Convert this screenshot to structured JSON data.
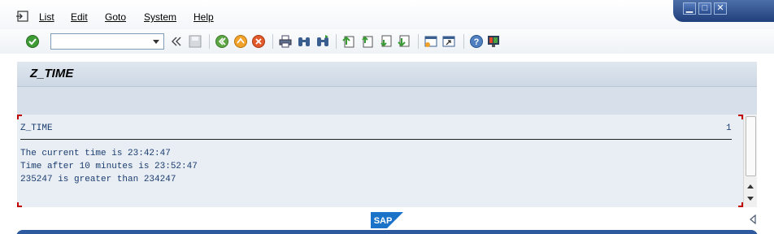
{
  "menubar": {
    "items": [
      {
        "label": "List"
      },
      {
        "label": "Edit"
      },
      {
        "label": "Goto"
      },
      {
        "label": "System"
      },
      {
        "label": "Help"
      }
    ]
  },
  "window_controls": {
    "minimize": "▁",
    "maximize": "□",
    "close": "✕"
  },
  "toolbar": {
    "command_field_value": "",
    "icons": [
      "enter-icon",
      "save-icon",
      "back-icon",
      "exit-icon",
      "cancel-icon",
      "print-icon",
      "find-icon",
      "find-next-icon",
      "first-page-icon",
      "previous-page-icon",
      "next-page-icon",
      "last-page-icon",
      "create-session-icon",
      "shortcut-icon",
      "help-icon",
      "customize-layout-icon"
    ]
  },
  "title": {
    "text": "Z_TIME"
  },
  "list": {
    "header_title": "Z_TIME",
    "page_number": "1",
    "lines": [
      "The current time is 23:42:47",
      "Time after 10 minutes is 23:52:47",
      "235247  is greater than  234247"
    ]
  },
  "footer": {
    "logo": "SAP"
  },
  "colors": {
    "accent": "#2d5a9e",
    "list_text": "#1a3c6e",
    "title_bg": "#d7e0ea"
  }
}
